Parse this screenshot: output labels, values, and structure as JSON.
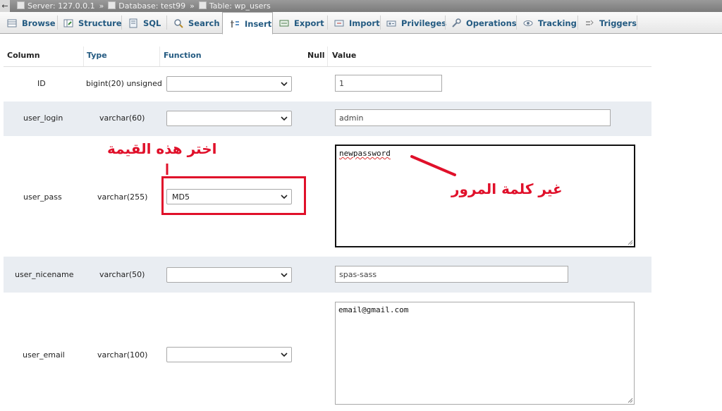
{
  "breadcrumb": {
    "back": "←",
    "server": "Server: 127.0.0.1",
    "database": "Database: test99",
    "table": "Table: wp_users",
    "separator": "»"
  },
  "tabs": [
    {
      "label": "Browse",
      "icon": "browse-icon"
    },
    {
      "label": "Structure",
      "icon": "structure-icon"
    },
    {
      "label": "SQL",
      "icon": "sql-icon"
    },
    {
      "label": "Search",
      "icon": "search-icon"
    },
    {
      "label": "Insert",
      "icon": "insert-icon",
      "active": true
    },
    {
      "label": "Export",
      "icon": "export-icon"
    },
    {
      "label": "Import",
      "icon": "import-icon"
    },
    {
      "label": "Privileges",
      "icon": "privileges-icon"
    },
    {
      "label": "Operations",
      "icon": "operations-icon"
    },
    {
      "label": "Tracking",
      "icon": "tracking-icon"
    },
    {
      "label": "Triggers",
      "icon": "triggers-icon"
    }
  ],
  "table": {
    "headers": {
      "column": "Column",
      "type": "Type",
      "function": "Function",
      "null": "Null",
      "value": "Value"
    },
    "rows": [
      {
        "column": "ID",
        "type": "bigint(20) unsigned",
        "function": "",
        "value": "1"
      },
      {
        "column": "user_login",
        "type": "varchar(60)",
        "function": "",
        "value": "admin"
      },
      {
        "column": "user_pass",
        "type": "varchar(255)",
        "function": "MD5",
        "value": "newpassword"
      },
      {
        "column": "user_nicename",
        "type": "varchar(50)",
        "function": "",
        "value": "spas-sass"
      },
      {
        "column": "user_email",
        "type": "varchar(100)",
        "function": "",
        "value": "email@gmail.com"
      }
    ]
  },
  "annotations": {
    "choose_value": "اختر هذه القيمة",
    "change_password": "غير كلمة المرور"
  },
  "colors": {
    "accent_link": "#235a81",
    "annotation_red": "#e0102a",
    "row_alt": "#e9edf2"
  }
}
